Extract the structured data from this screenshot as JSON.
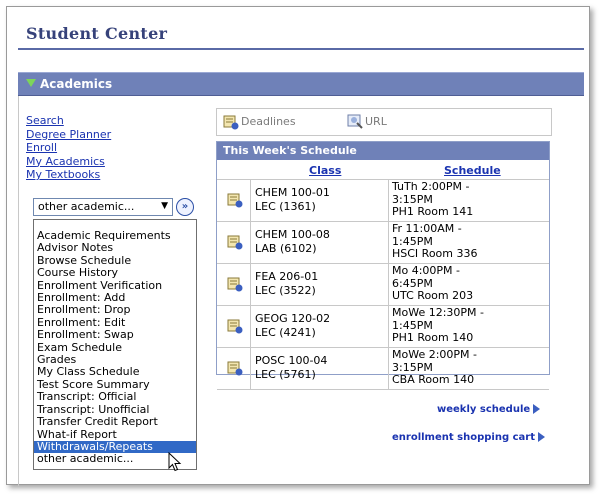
{
  "page": {
    "title": "Student Center"
  },
  "section": {
    "title": "Academics"
  },
  "links": [
    "Search",
    "Degree Planner",
    "Enroll",
    "My Academics",
    "My Textbooks"
  ],
  "select": {
    "value": "other academic...",
    "go_label": "»"
  },
  "dropdown": {
    "options": [
      "Academic Requirements",
      "Advisor Notes",
      "Browse Schedule",
      "Course History",
      "Enrollment Verification",
      "Enrollment: Add",
      "Enrollment: Drop",
      "Enrollment: Edit",
      "Enrollment: Swap",
      "Exam Schedule",
      "Grades",
      "My Class Schedule",
      "Test Score Summary",
      "Transcript: Official",
      "Transcript: Unofficial",
      "Transfer Credit Report",
      "What-if Report",
      "Withdrawals/Repeats",
      "other academic..."
    ],
    "selected": "Withdrawals/Repeats"
  },
  "tabs": {
    "deadlines": "Deadlines",
    "url": "URL"
  },
  "schedule": {
    "title": "This Week's Schedule",
    "col_class": "Class",
    "col_schedule": "Schedule",
    "rows": [
      {
        "class1": "CHEM 100-01",
        "class2": "LEC (1361)",
        "s1": "TuTh 2:00PM -",
        "s2": "3:15PM",
        "s3": "PH1  Room 141"
      },
      {
        "class1": "CHEM 100-08",
        "class2": "LAB (6102)",
        "s1": "Fr 11:00AM -",
        "s2": "1:45PM",
        "s3": "HSCI Room 336"
      },
      {
        "class1": "FEA 206-01",
        "class2": "LEC (3522)",
        "s1": "Mo 4:00PM -",
        "s2": "6:45PM",
        "s3": "UTC  Room 203"
      },
      {
        "class1": "GEOG 120-02",
        "class2": "LEC (4241)",
        "s1": "MoWe 12:30PM -",
        "s2": "1:45PM",
        "s3": "PH1  Room 140"
      },
      {
        "class1": "POSC 100-04",
        "class2": "LEC (5761)",
        "s1": "MoWe 2:00PM -",
        "s2": "3:15PM",
        "s3": "CBA  Room 140"
      }
    ]
  },
  "footer": {
    "weekly": "weekly schedule",
    "cart": "enrollment shopping cart"
  },
  "colors": {
    "header_bg": "#6f81b8",
    "title": "#36427a",
    "link": "#1a33b0",
    "selected": "#3169c6"
  }
}
